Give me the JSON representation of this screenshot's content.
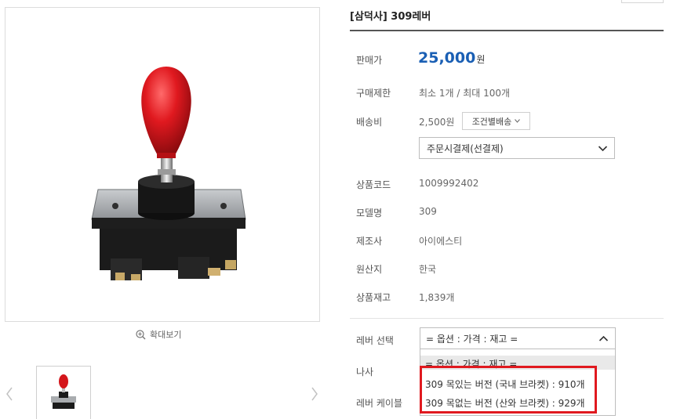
{
  "product": {
    "title": "[삼덕사] 309레버",
    "zoom_label": "확대보기"
  },
  "info": {
    "price_label": "판매가",
    "price_value": "25,000",
    "price_unit": "원",
    "limit_label": "구매제한",
    "limit_value": "최소 1개 / 최대 100개",
    "shipping_label": "배송비",
    "shipping_value": "2,500원",
    "shipping_cond_label": "조건별배송",
    "payment_select_value": "주문시결제(선결제)",
    "code_label": "상품코드",
    "code_value": "1009992402",
    "model_label": "모델명",
    "model_value": "309",
    "maker_label": "제조사",
    "maker_value": "아이에스티",
    "origin_label": "원산지",
    "origin_value": "한국",
    "stock_label": "상품재고",
    "stock_value": "1,839개"
  },
  "options": {
    "lever_label": "레버 선택",
    "lever_select_value": "= 옵션 : 가격 : 재고 =",
    "screw_label": "나사",
    "cable_label": "레버 케이블",
    "dropdown_items": [
      "= 옵션 : 가격 : 재고 =",
      "309 목있는 버전 (국내 브라켓) : 910개",
      "309 목없는 버전 (산와 브라켓) : 929개"
    ]
  },
  "colors": {
    "price": "#1a5fb4",
    "highlight": "#e0191f",
    "lever_knob": "#d4161b"
  }
}
